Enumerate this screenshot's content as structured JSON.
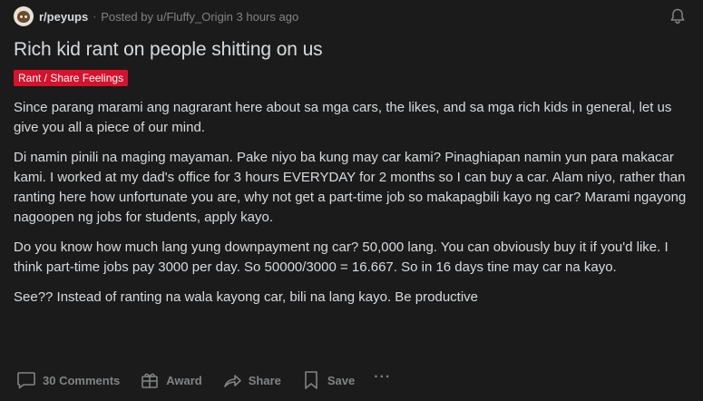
{
  "post": {
    "subreddit": "r/peyups",
    "separator": "·",
    "posted_by": "Posted by u/Fluffy_Origin 3 hours ago",
    "title": "Rich kid rant on people shitting on us",
    "flair": "Rant / Share Feelings",
    "flair_color": "#d8122c",
    "paragraphs": [
      "Since parang marami ang nagrarant here about sa mga cars, the likes, and sa mga rich kids in general, let us give you all a piece of our mind.",
      "Di namin pinili na maging mayaman. Pake niyo ba kung may car kami? Pinaghiapan namin yun para makacar kami. I worked at my dad's office for 3 hours EVERYDAY for 2 months so I can buy a car. Alam niyo, rather than ranting here how unfortunate you are, why not get a part-time job so makapagbili kayo ng car? Marami ngayong nagoopen ng jobs for students, apply kayo.",
      "Do you know how much lang yung downpayment ng car? 50,000 lang. You can obviously buy it if you'd like. I think part-time jobs pay 3000 per day. So 50000/3000 = 16.667. So in 16 days tine may car na kayo.",
      "See?? Instead of ranting na wala kayong car, bili na lang kayo. Be productive"
    ]
  },
  "actions": {
    "comments_label": "30 Comments",
    "award_label": "Award",
    "share_label": "Share",
    "save_label": "Save",
    "more_label": "···"
  },
  "icons": {
    "avatar": "subreddit-avatar",
    "bell": "bell-icon",
    "comments": "comment-icon",
    "award": "award-icon",
    "share": "share-icon",
    "save": "bookmark-icon"
  },
  "colors": {
    "background": "#1b1b1c",
    "text": "#d7dadc",
    "muted": "#818384"
  }
}
